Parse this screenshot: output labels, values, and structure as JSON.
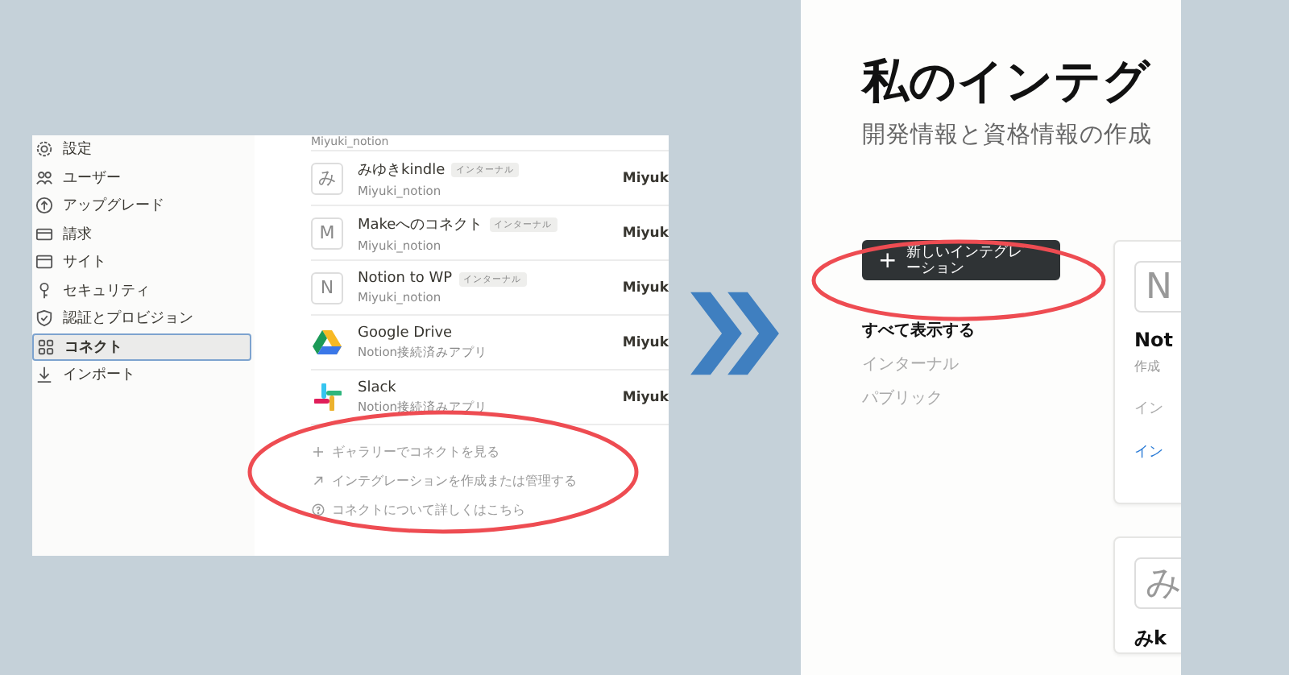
{
  "left_screenshot": {
    "sidebar": {
      "items": [
        {
          "label": "設定",
          "selected": false
        },
        {
          "label": "ユーザー",
          "selected": false
        },
        {
          "label": "アップグレード",
          "selected": false
        },
        {
          "label": "請求",
          "selected": false
        },
        {
          "label": "サイト",
          "selected": false
        },
        {
          "label": "セキュリティ",
          "selected": false
        },
        {
          "label": "認証とプロビジョン",
          "selected": false
        },
        {
          "label": "コネクト",
          "selected": true
        },
        {
          "label": "インポート",
          "selected": false
        }
      ]
    },
    "connections": {
      "partial_row_subtitle": "Miyuki_notion",
      "rows": [
        {
          "kind": "letter",
          "icon_text": "み",
          "name": "みゆきkindle",
          "badge": "インターナル",
          "subtitle": "Miyuki_notion",
          "column_2": "Miyuk"
        },
        {
          "kind": "letter",
          "icon_text": "M",
          "name": "Makeへのコネクト",
          "badge": "インターナル",
          "subtitle": "Miyuki_notion",
          "column_2": "Miyuk"
        },
        {
          "kind": "letter",
          "icon_text": "N",
          "name": "Notion to WP",
          "badge": "インターナル",
          "subtitle": "Miyuki_notion",
          "column_2": "Miyuk"
        },
        {
          "kind": "drive",
          "name": "Google Drive",
          "subtitle": "Notion接続済みアプリ",
          "column_2": "Miyuk"
        },
        {
          "kind": "slack",
          "name": "Slack",
          "subtitle": "Notion接続済みアプリ",
          "column_2": "Miyuk"
        }
      ]
    },
    "links": [
      {
        "kind": "plus",
        "label": "ギャラリーでコネクトを見る"
      },
      {
        "kind": "arrow",
        "label": "インテグレーションを作成または管理する"
      },
      {
        "kind": "help",
        "label": "コネクトについて詳しくはこちら"
      }
    ]
  },
  "right_screenshot": {
    "title": "私のインテグ",
    "subtitle": "開発情報と資格情報の作成",
    "new_button": {
      "icon_text": "+",
      "label": "新しいインテグレーション"
    },
    "filters": [
      {
        "label": "すべて表示する",
        "selected": true
      },
      {
        "label": "インターナル",
        "selected": false
      },
      {
        "label": "パブリック",
        "selected": false
      }
    ],
    "cards": [
      {
        "icon_text": "N",
        "name": "Not",
        "meta": "作成",
        "info": "イン",
        "link": "イン"
      },
      {
        "icon_text": "み",
        "name": "みk"
      }
    ]
  }
}
